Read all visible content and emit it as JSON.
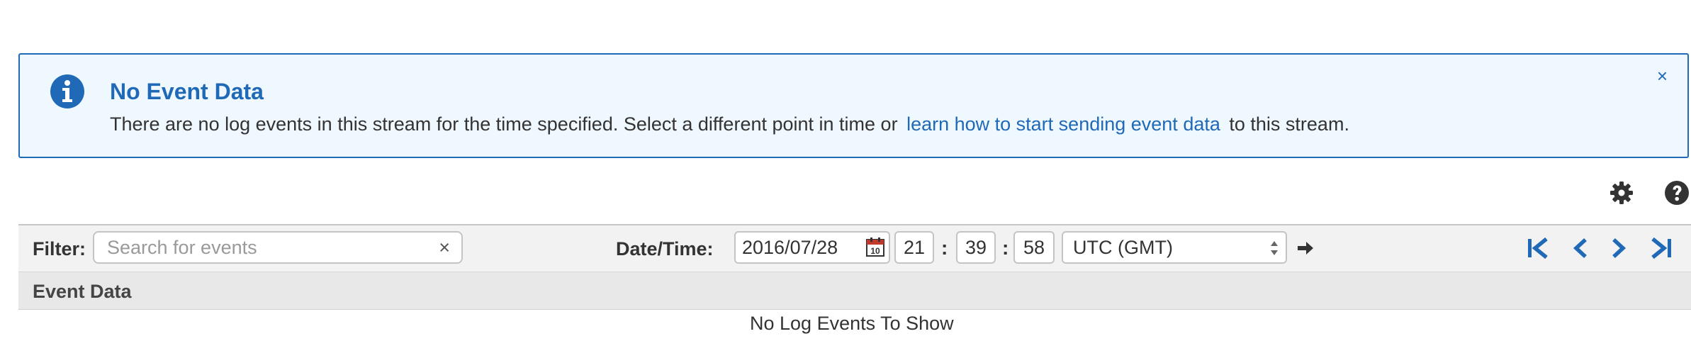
{
  "alert": {
    "icon": "info-icon",
    "title": "No Event Data",
    "message_before": "There are no log events in this stream for the time specified. Select a different point in time or",
    "link_text": "learn how to start sending event data",
    "message_after": "to this stream.",
    "close_label": "×",
    "accent_color": "#1f69b7",
    "background_color": "#eff8ff"
  },
  "top_icons": {
    "settings_icon": "gear-icon",
    "help_icon": "help-icon"
  },
  "toolbar": {
    "filter_label": "Filter:",
    "search_placeholder": "Search for events",
    "search_value": "",
    "search_clear_label": "×",
    "datetime_label": "Date/Time:",
    "date_value": "2016/07/28",
    "calendar_icon_day": "10",
    "hour": "21",
    "minute": "39",
    "second": "58",
    "time_separator": ":",
    "timezone": "UTC (GMT)",
    "go_icon": "arrow-right-icon",
    "nav_icons": [
      "first-page-icon",
      "previous-page-icon",
      "next-page-icon",
      "last-page-icon"
    ],
    "nav_color": "#1f69b7"
  },
  "table": {
    "column_header": "Event Data",
    "empty_message": "No Log Events To Show"
  }
}
